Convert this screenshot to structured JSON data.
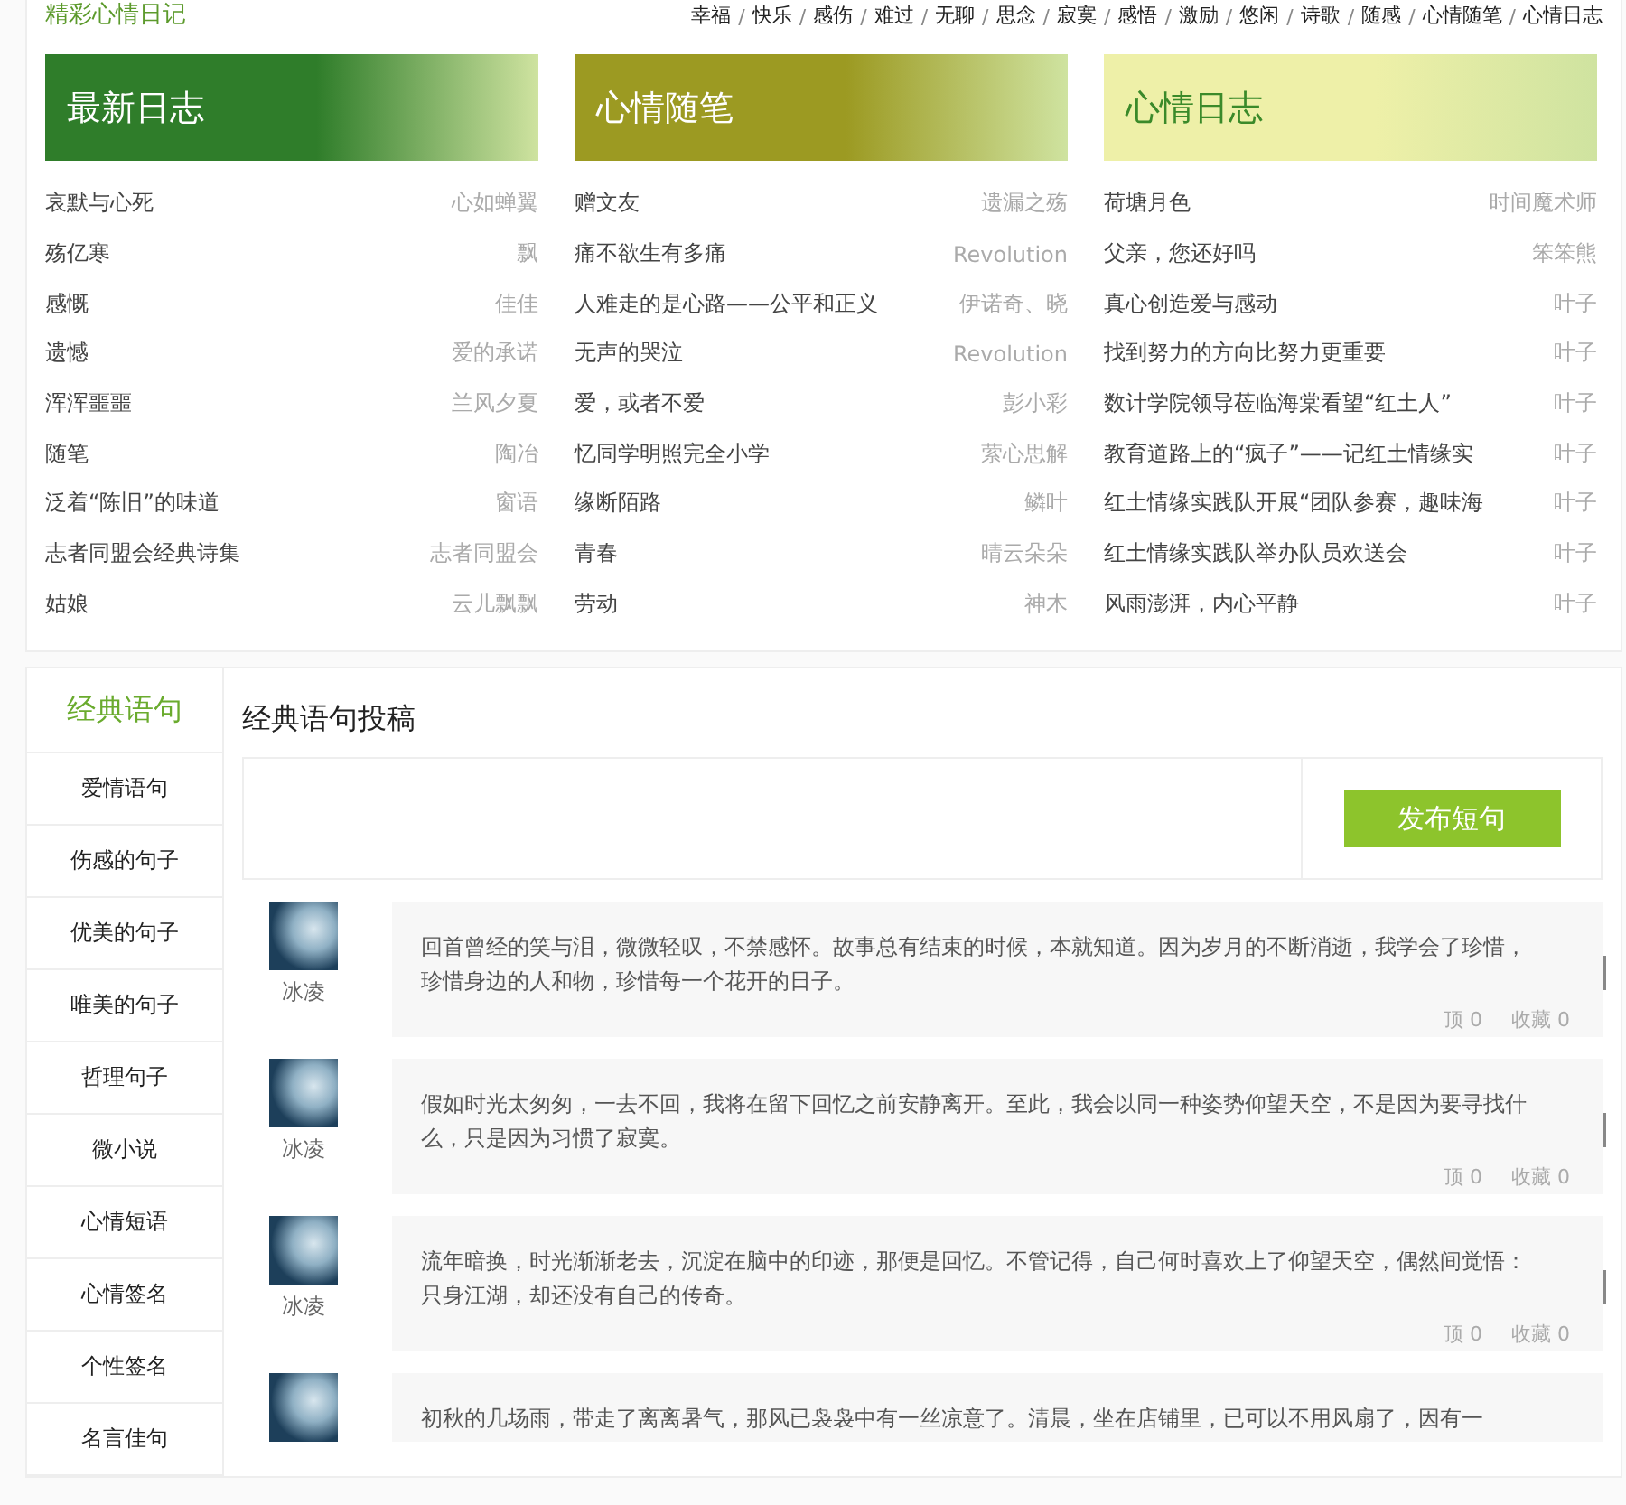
{
  "header": {
    "site_title": "精彩心情日记",
    "nav": [
      "幸福",
      "快乐",
      "感伤",
      "难过",
      "无聊",
      "思念",
      "寂寞",
      "感悟",
      "激励",
      "悠闲",
      "诗歌",
      "随感",
      "心情随笔",
      "心情日志"
    ],
    "separator": "/"
  },
  "columns": [
    {
      "title": "最新日志",
      "color": "#2f7d2a",
      "entries": [
        {
          "title": "哀默与心死",
          "author": "心如蝉翼"
        },
        {
          "title": "殇亿寒",
          "author": "飘"
        },
        {
          "title": "感慨",
          "author": "佳佳"
        },
        {
          "title": "遗憾",
          "author": "爱的承诺"
        },
        {
          "title": "浑浑噩噩",
          "author": "兰风夕夏"
        },
        {
          "title": "随笔",
          "author": "陶冶"
        },
        {
          "title": "泛着“陈旧”的味道",
          "author": "窗语"
        },
        {
          "title": "志者同盟会经典诗集",
          "author": "志者同盟会"
        },
        {
          "title": "姑娘",
          "author": "云儿飘飘"
        }
      ]
    },
    {
      "title": "心情随笔",
      "color": "#9c9a22",
      "entries": [
        {
          "title": "赠文友",
          "author": "遗漏之殇"
        },
        {
          "title": "痛不欲生有多痛",
          "author": "Revolution"
        },
        {
          "title": "人难走的是心路——公平和正义",
          "author": "伊诺奇、晓"
        },
        {
          "title": "无声的哭泣",
          "author": "Revolution"
        },
        {
          "title": "爱，或者不爱",
          "author": "彭小彩"
        },
        {
          "title": "忆同学明照完全小学",
          "author": "萦心思解"
        },
        {
          "title": "缘断陌路",
          "author": "鳞叶"
        },
        {
          "title": "青春",
          "author": "晴云朵朵"
        },
        {
          "title": "劳动",
          "author": "神木"
        }
      ]
    },
    {
      "title": "心情日志",
      "color": "#eef0a8",
      "entries": [
        {
          "title": "荷塘月色",
          "author": "时间魔术师"
        },
        {
          "title": "父亲，您还好吗",
          "author": "笨笨熊"
        },
        {
          "title": "真心创造爱与感动",
          "author": "叶子"
        },
        {
          "title": "找到努力的方向比努力更重要",
          "author": "叶子"
        },
        {
          "title": "数计学院领导莅临海棠看望“红土人”",
          "author": "叶子"
        },
        {
          "title": "教育道路上的“疯子”——记红土情缘实",
          "author": "叶子"
        },
        {
          "title": "红土情缘实践队开展“团队参赛，趣味海",
          "author": "叶子"
        },
        {
          "title": "红土情缘实践队举办队员欢送会",
          "author": "叶子"
        },
        {
          "title": "风雨澎湃，内心平静",
          "author": "叶子"
        }
      ]
    }
  ],
  "sidebar": {
    "title": "经典语句",
    "items": [
      "爱情语句",
      "伤感的句子",
      "优美的句子",
      "唯美的句子",
      "哲理句子",
      "微小说",
      "心情短语",
      "心情签名",
      "个性签名",
      "名言佳句"
    ]
  },
  "submit": {
    "title": "经典语句投稿",
    "button": "发布短句"
  },
  "posts": [
    {
      "author": "冰凌",
      "text": "回首曾经的笑与泪，微微轻叹，不禁感怀。故事总有结束的时候，本就知道。因为岁月的不断消逝，我学会了珍惜，珍惜身边的人和物，珍惜每一个花开的日子。",
      "likes": "顶 0",
      "favorites": "收藏 0"
    },
    {
      "author": "冰凌",
      "text": "假如时光太匆匆，一去不回，我将在留下回忆之前安静离开。至此，我会以同一种姿势仰望天空，不是因为要寻找什么，只是因为习惯了寂寞。",
      "likes": "顶 0",
      "favorites": "收藏 0"
    },
    {
      "author": "冰凌",
      "text": "流年暗换，时光渐渐老去，沉淀在脑中的印迹，那便是回忆。不管记得，自己何时喜欢上了仰望天空，偶然间觉悟：只身江湖，却还没有自己的传奇。",
      "likes": "顶 0",
      "favorites": "收藏 0"
    },
    {
      "text": "初秋的几场雨，带走了离离暑气，那风已袅袅中有一丝凉意了。清晨，坐在店铺里，已可以不用风扇了，因有一"
    }
  ]
}
